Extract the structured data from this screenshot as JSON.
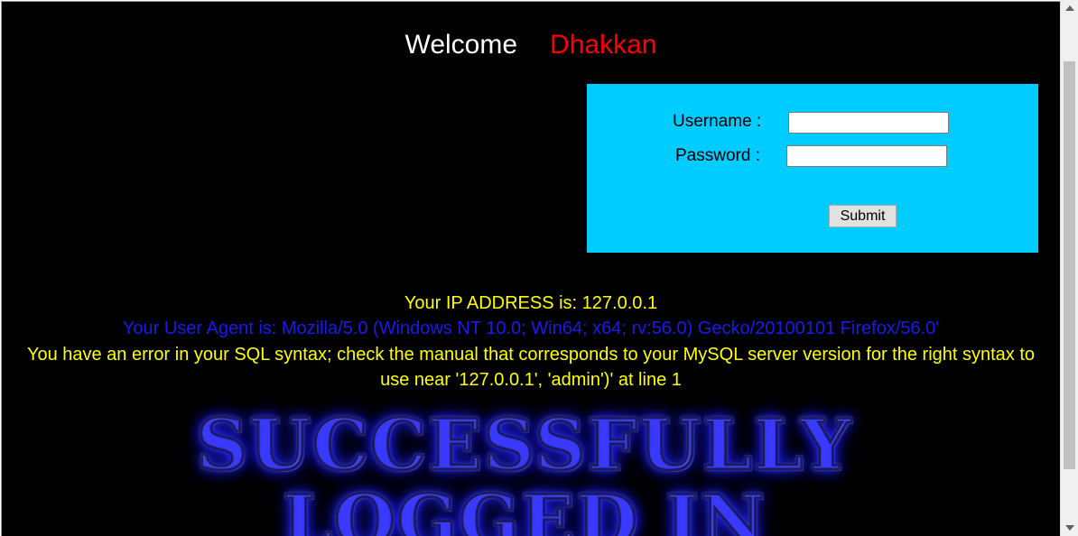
{
  "header": {
    "welcome": "Welcome",
    "name": "Dhakkan"
  },
  "login": {
    "username_label": "Username :",
    "password_label": "Password :",
    "username_value": "",
    "password_value": "",
    "submit_label": "Submit"
  },
  "info": {
    "ip": "Your IP ADDRESS is: 127.0.0.1",
    "user_agent": "Your User Agent is: Mozilla/5.0 (Windows NT 10.0; Win64; x64; rv:56.0) Gecko/20100101 Firefox/56.0'",
    "error": "You have an error in your SQL syntax; check the manual that corresponds to your MySQL server version for the right syntax to use near '127.0.0.1', 'admin')' at line 1"
  },
  "banner": {
    "line1": "SUCCESSFULLY",
    "line2": "LOGGED IN"
  },
  "colors": {
    "background": "#000000",
    "name": "#ff0000",
    "login_box": "#00ccff",
    "ip_text": "#ffff00",
    "user_agent_text": "#1a1af0",
    "error_text": "#ffff00"
  }
}
